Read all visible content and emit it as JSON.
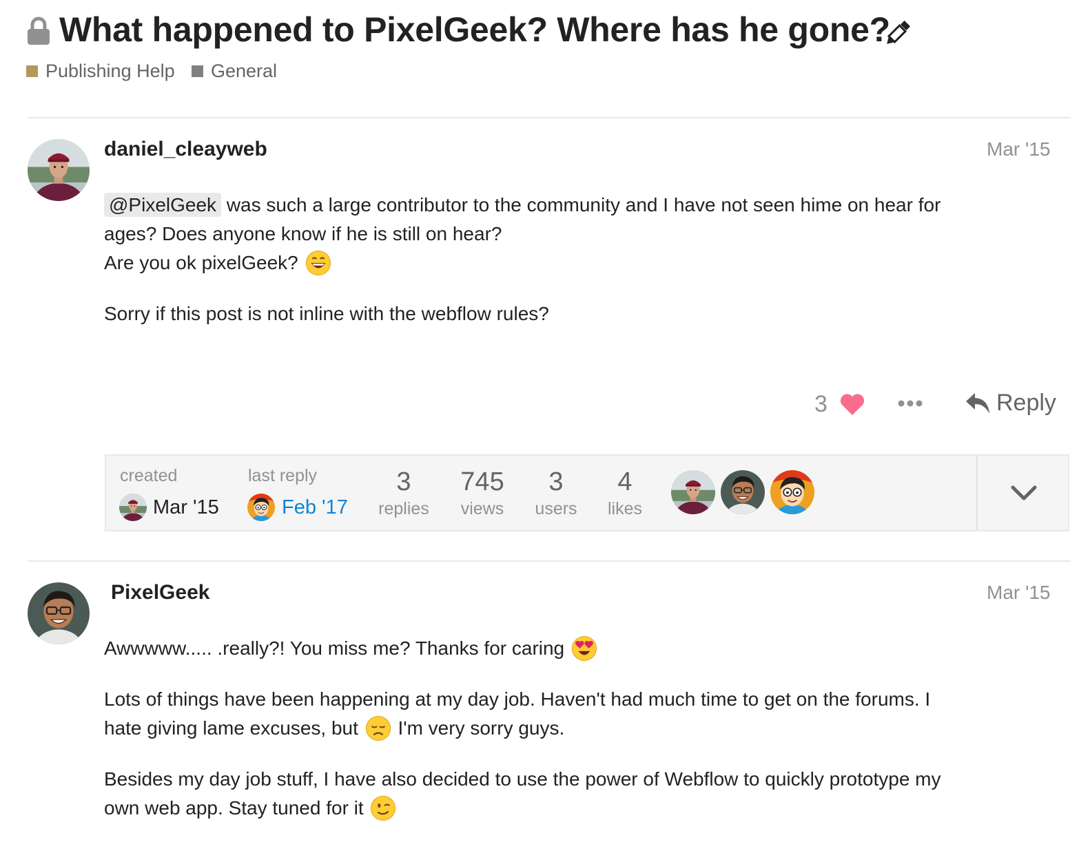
{
  "topic": {
    "title": "What happened to PixelGeek? Where has he gone?",
    "categories": [
      {
        "name": "Publishing Help",
        "color": "#b3985e"
      },
      {
        "name": "General",
        "color": "#808080"
      }
    ]
  },
  "posts": [
    {
      "username": "daniel_cleayweb",
      "date": "Mar '15",
      "mention": "@PixelGeek",
      "line1_rest": " was such a large contributor to the community and I have not seen hime on hear for",
      "line2": "ages? Does anyone know if he is still on hear?",
      "line3": "Are you ok pixelGeek?",
      "paragraph2": "Sorry if this post is not inline with the webflow rules?",
      "likes": "3",
      "reply_label": "Reply"
    },
    {
      "username": "PixelGeek",
      "date": "Mar '15",
      "paragraph1": "Awwwww..... .really?! You miss me? Thanks for caring",
      "paragraph2a": "Lots of things have been happening at my day job. Haven't had much time to get on the forums. I",
      "paragraph2b": "hate giving lame excuses, but",
      "paragraph2c": " I'm very sorry guys.",
      "paragraph3a": "Besides my day job stuff, I have also decided to use the power of Webflow to quickly prototype my",
      "paragraph3b": "own web app. Stay tuned for it"
    }
  ],
  "topic_map": {
    "created_label": "created",
    "created_date": "Mar '15",
    "last_reply_label": "last reply",
    "last_reply_date": "Feb '17",
    "stats": [
      {
        "value": "3",
        "label": "replies"
      },
      {
        "value": "745",
        "label": "views"
      },
      {
        "value": "3",
        "label": "users"
      },
      {
        "value": "4",
        "label": "likes"
      }
    ]
  },
  "colors": {
    "link_blue": "#0a84d6",
    "heart": "#fa6c8d",
    "muted": "#919191"
  },
  "icons": [
    "lock-icon",
    "pencil-icon",
    "heart-icon",
    "more-icon",
    "reply-icon",
    "chevron-down-icon"
  ],
  "emojis": [
    "smile",
    "heart-eyes",
    "disappointed",
    "wink"
  ]
}
